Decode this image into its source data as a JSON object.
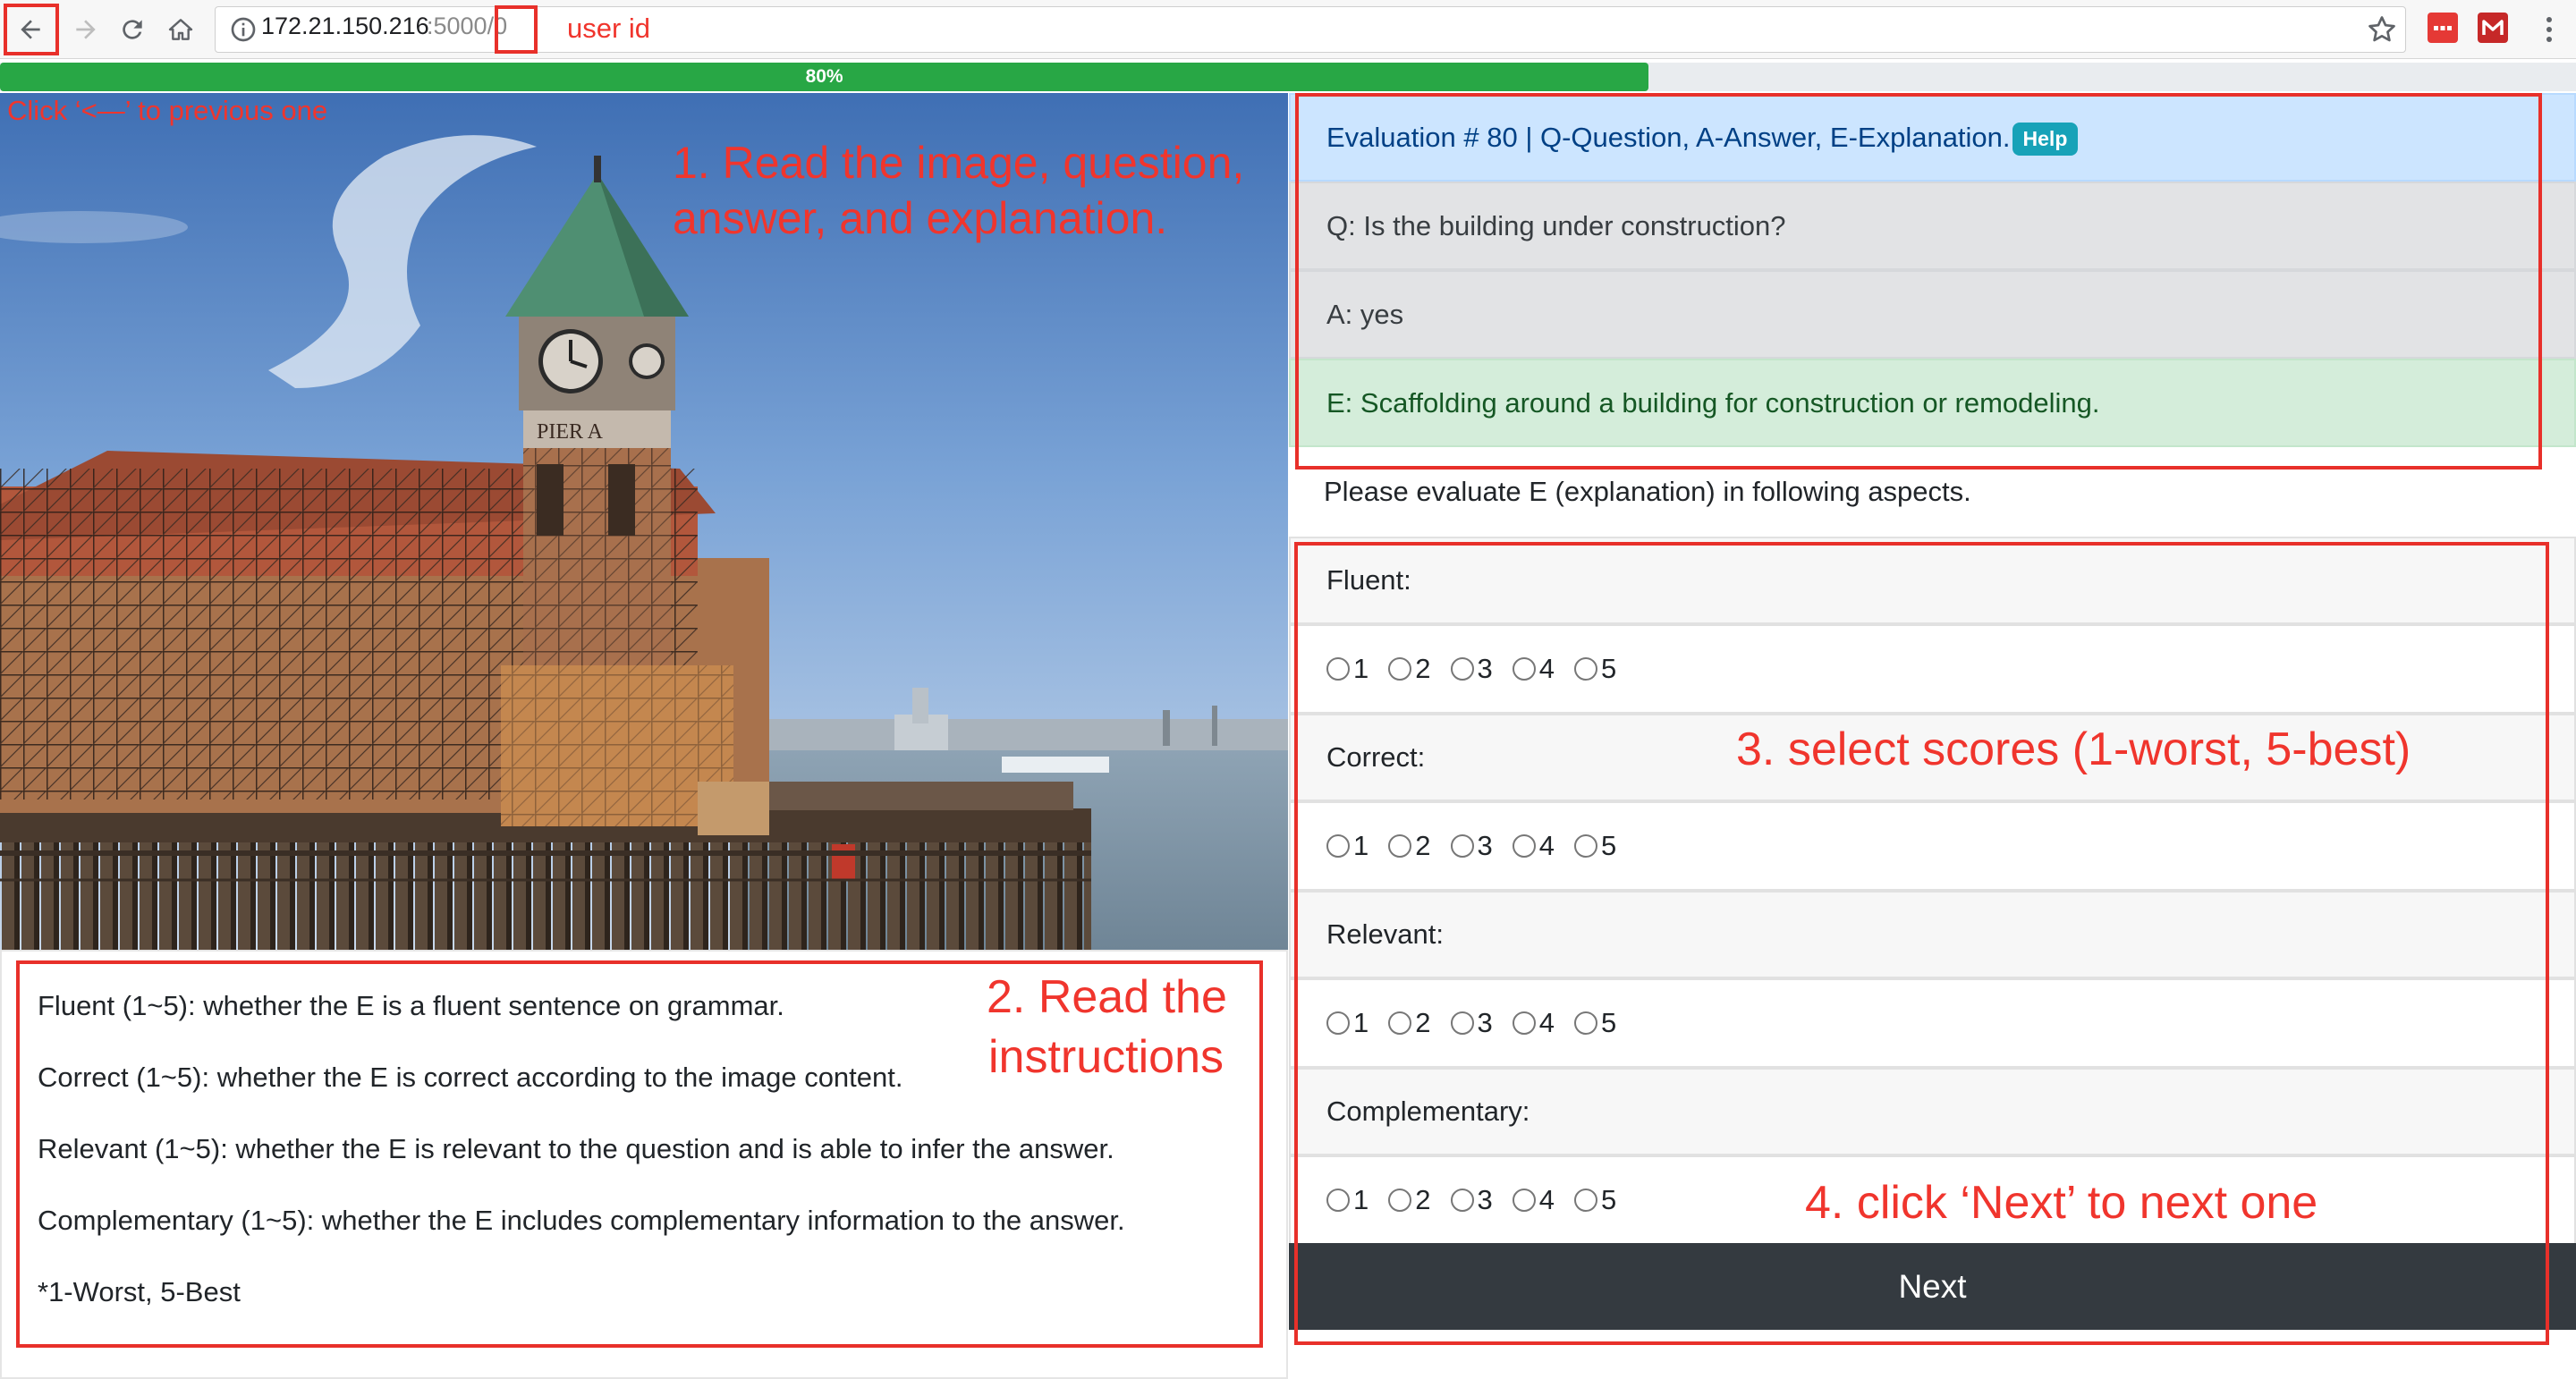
{
  "browser": {
    "url_host": "172.21.150.216",
    "url_path": ":5000/0"
  },
  "progress": {
    "label": "80%",
    "value": 0.8
  },
  "evaluation": {
    "title": "Evaluation # 80 | Q-Question, A-Answer, E-Explanation.",
    "help_label": "Help",
    "question": "Q: Is the building under construction?",
    "answer": "A: yes",
    "explanation": "E: Scaffolding around a building for construction or remodeling.",
    "prompt": "Please evaluate E (explanation) in following aspects."
  },
  "aspects": [
    {
      "label": "Fluent:",
      "options": [
        "1",
        "2",
        "3",
        "4",
        "5"
      ]
    },
    {
      "label": "Correct:",
      "options": [
        "1",
        "2",
        "3",
        "4",
        "5"
      ]
    },
    {
      "label": "Relevant:",
      "options": [
        "1",
        "2",
        "3",
        "4",
        "5"
      ]
    },
    {
      "label": "Complementary:",
      "options": [
        "1",
        "2",
        "3",
        "4",
        "5"
      ]
    }
  ],
  "next_label": "Next",
  "instructions": [
    "Fluent (1~5): whether the E is a fluent sentence on grammar.",
    "Correct (1~5): whether the E is correct according to the image content.",
    "Relevant (1~5): whether the E is relevant to the question and is able to infer the answer.",
    "Complementary (1~5): whether the E includes complementary information to the answer.",
    "*1-Worst, 5-Best"
  ],
  "photo": {
    "sign_text": "PIER A"
  },
  "annotations": {
    "user_id": "user id",
    "back_hint": "Click ‘<—’ to previous one",
    "step1_line1": "1. Read the image, question,",
    "step1_line2": "answer, and explanation.",
    "step2_line1": "2. Read the",
    "step2_line2": "instructions",
    "step3": "3. select scores (1-worst, 5-best)",
    "step4": "4. click ‘Next’ to next one"
  },
  "colors": {
    "annotation_red": "#e8302a",
    "progress_green": "#28a745",
    "next_button": "#343a40",
    "title_bar": "#cce5ff",
    "explanation_bar": "#d4edda"
  }
}
